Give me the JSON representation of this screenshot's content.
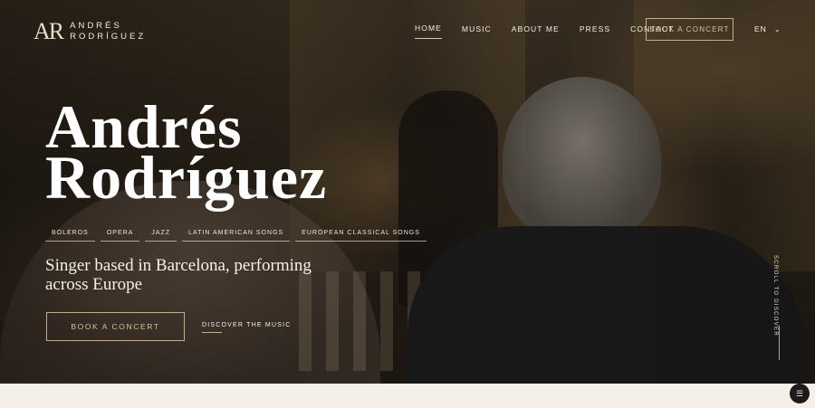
{
  "header": {
    "logo_mark": "AR",
    "logo_line1": "ANDRÉS",
    "logo_line2": "RODRÍGUEZ",
    "nav": [
      {
        "label": "HOME"
      },
      {
        "label": "MUSIC"
      },
      {
        "label": "ABOUT ME"
      },
      {
        "label": "PRESS"
      },
      {
        "label": "CONTACT"
      }
    ],
    "cta_label": "BOOK A CONCERT",
    "language": "EN"
  },
  "hero": {
    "title_line1": "Andrés",
    "title_line2": "Rodríguez",
    "tags": [
      "BOLEROS",
      "OPERA",
      "JAZZ",
      "LATIN AMERICAN SONGS",
      "EUROPEAN CLASSICAL SONGS"
    ],
    "subtitle": "Singer based in Barcelona, performing across Europe",
    "book_button": "BOOK A CONCERT",
    "discover_link": "DISCOVER THE MUSIC",
    "scroll_hint": "SCROLL TO DISCOVER"
  },
  "icons": {
    "language_chevron": "chevron-down-icon",
    "chat_widget": "chat-icon"
  },
  "colors": {
    "accent_gold": "#c7ad82",
    "text_light": "#f4efe6",
    "band": "#f4efe8"
  }
}
